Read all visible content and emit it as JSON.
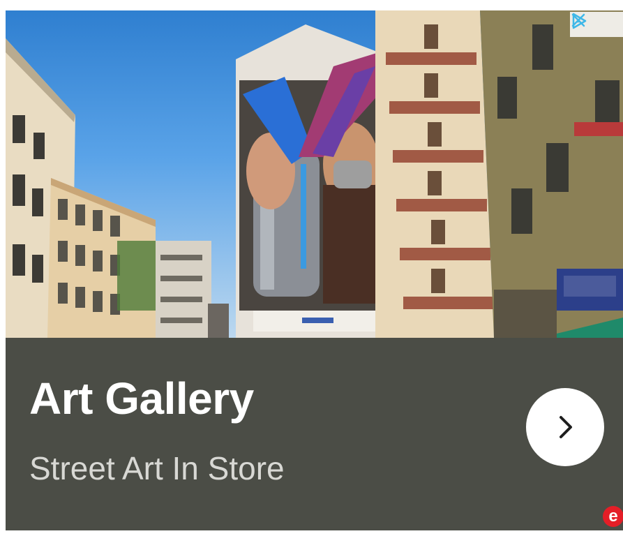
{
  "ad": {
    "title": "Art Gallery",
    "subtitle": "Street Art In Store",
    "image": {
      "icon": "street-art-mural-photo"
    },
    "adchoices": {
      "info_icon": "adchoices-triangle-icon",
      "close_icon": "close-icon"
    },
    "cta": {
      "icon": "chevron-right-icon"
    },
    "brand": {
      "glyph": "e",
      "color": "#e41e27"
    },
    "colors": {
      "caption_bg": "#4b4d46",
      "title": "#ffffff",
      "subtitle": "#d8d8d4",
      "adchoices": "#3fb8e8"
    }
  }
}
